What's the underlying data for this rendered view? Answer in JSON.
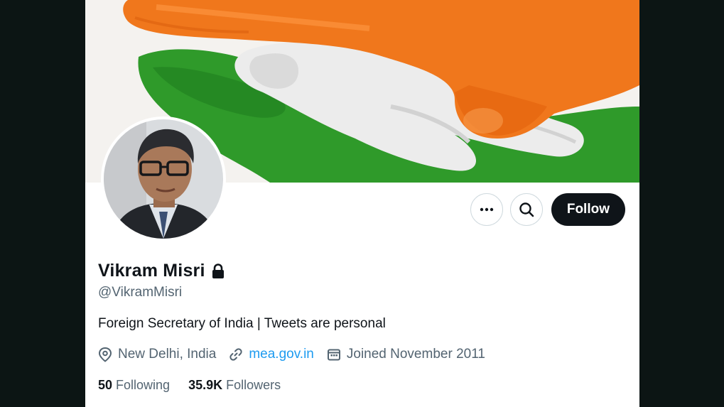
{
  "profile": {
    "name": "Vikram Misri",
    "handle": "@VikramMisri",
    "bio": "Foreign Secretary of India | Tweets are personal",
    "location": "New Delhi, India",
    "website": "mea.gov.in",
    "joined": "Joined November 2011",
    "following_count": "50",
    "following_label": "Following",
    "followers_count": "35.9K",
    "followers_label": "Followers"
  },
  "actions": {
    "more_label": "More",
    "search_label": "Search",
    "follow_label": "Follow"
  },
  "colors": {
    "accent": "#1d9bf0",
    "text": "#0f1419",
    "muted": "#536471",
    "saffron": "#f0771c",
    "green": "#2f9a2a"
  },
  "icons": {
    "lock": "lock-icon",
    "location": "location-pin-icon",
    "link": "link-icon",
    "calendar": "calendar-icon",
    "more": "more-dots-icon",
    "search": "search-icon"
  }
}
